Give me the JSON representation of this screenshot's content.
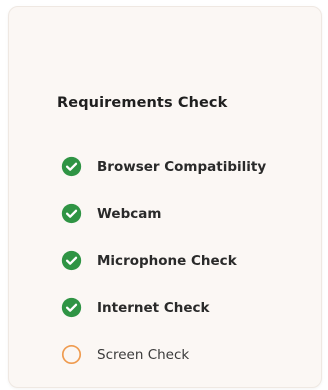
{
  "colors": {
    "done": "#2f9444",
    "pending": "#ef9b4f"
  },
  "requirements": {
    "title": "Requirements Check",
    "items": [
      {
        "label": "Browser Compatibility",
        "status": "done",
        "icon": "check-circle-icon"
      },
      {
        "label": "Webcam",
        "status": "done",
        "icon": "check-circle-icon"
      },
      {
        "label": "Microphone Check",
        "status": "done",
        "icon": "check-circle-icon"
      },
      {
        "label": "Internet Check",
        "status": "done",
        "icon": "check-circle-icon"
      },
      {
        "label": "Screen Check",
        "status": "pending",
        "icon": "empty-circle-icon"
      }
    ]
  }
}
